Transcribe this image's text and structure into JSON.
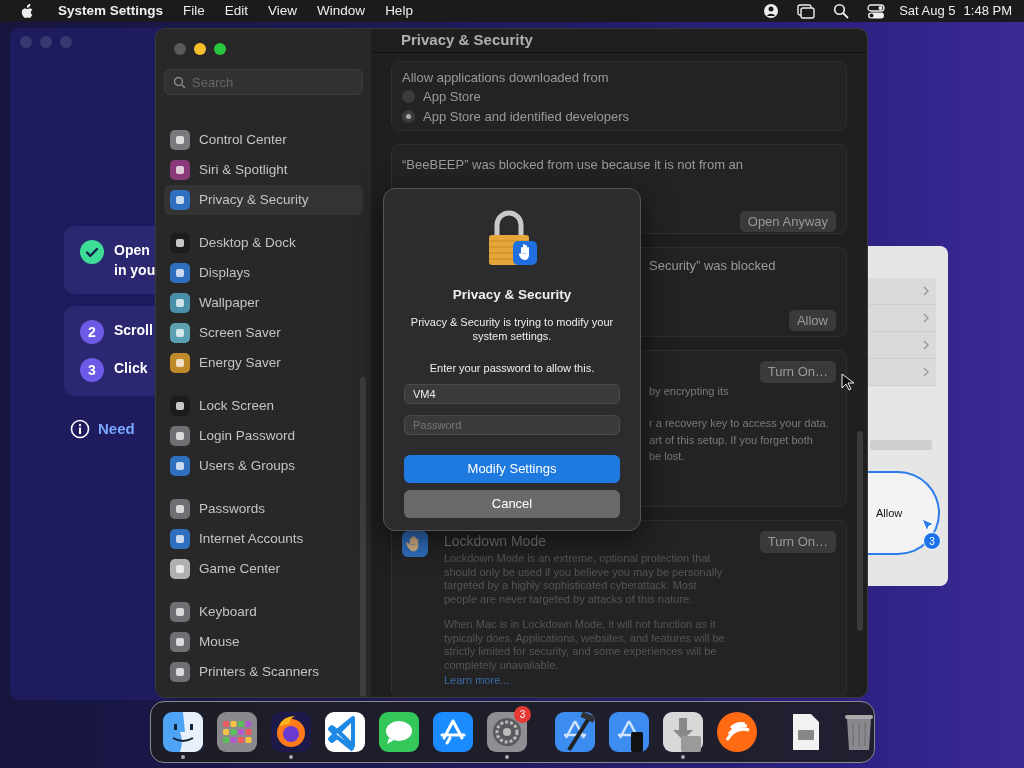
{
  "menubar": {
    "app": "System Settings",
    "menus": [
      "File",
      "Edit",
      "View",
      "Window",
      "Help"
    ],
    "date": "Sat Aug 5",
    "time": "1:48 PM"
  },
  "guide_window": {
    "cards": [
      {
        "steps": [
          {
            "lines": [
              "Open",
              "in you"
            ],
            "done": true
          }
        ]
      },
      {
        "steps": [
          {
            "number": "2",
            "lines": [
              "Scroll"
            ],
            "done": false
          },
          {
            "number": "3",
            "lines": [
              "Click"
            ],
            "done": false
          }
        ]
      }
    ],
    "help_link": "Need"
  },
  "tutorial_window": {
    "callout": {
      "label": "Allow",
      "badge": "3"
    }
  },
  "settings": {
    "search": {
      "placeholder": "Search"
    },
    "sidebar": {
      "groups": [
        {
          "items": [
            {
              "label": "Control Center",
              "color": "#7a7a7e",
              "selected": false
            },
            {
              "label": "Siri & Spotlight",
              "color": "#8a3a7a",
              "selected": false
            },
            {
              "label": "Privacy & Security",
              "color": "#2f6fc0",
              "selected": true
            }
          ]
        },
        {
          "items": [
            {
              "label": "Desktop & Dock",
              "color": "#1c1c1e",
              "selected": false
            },
            {
              "label": "Displays",
              "color": "#2f6fc0",
              "selected": false
            },
            {
              "label": "Wallpaper",
              "color": "#4a8fa8",
              "selected": false
            },
            {
              "label": "Screen Saver",
              "color": "#5aa0b0",
              "selected": false
            },
            {
              "label": "Energy Saver",
              "color": "#c08a2a",
              "selected": false
            }
          ]
        },
        {
          "items": [
            {
              "label": "Lock Screen",
              "color": "#1c1c1e",
              "selected": false
            },
            {
              "label": "Login Password",
              "color": "#6e6e73",
              "selected": false
            },
            {
              "label": "Users & Groups",
              "color": "#2f6fc0",
              "selected": false
            }
          ]
        },
        {
          "items": [
            {
              "label": "Passwords",
              "color": "#6e6e73",
              "selected": false
            },
            {
              "label": "Internet Accounts",
              "color": "#2f6fc0",
              "selected": false
            },
            {
              "label": "Game Center",
              "color": "#b0b0b0",
              "selected": false
            }
          ]
        },
        {
          "items": [
            {
              "label": "Keyboard",
              "color": "#6e6e73",
              "selected": false
            },
            {
              "label": "Mouse",
              "color": "#6e6e73",
              "selected": false
            },
            {
              "label": "Printers & Scanners",
              "color": "#6e6e73",
              "selected": false
            }
          ]
        }
      ]
    },
    "title": "Privacy & Security",
    "sections": [
      {
        "kind": "radios",
        "heading": "Allow applications downloaded from",
        "options": [
          {
            "label": "App Store",
            "selected": false
          },
          {
            "label": "App Store and identified developers",
            "selected": true
          }
        ]
      },
      {
        "kind": "notice",
        "text": "“BeeBEEP” was blocked from use because it is not from an",
        "button": "Open Anyway"
      },
      {
        "kind": "covered_notice",
        "paragraphs": [
          [
            "Security” was blocked"
          ]
        ],
        "button": "Allow",
        "button_first": false
      },
      {
        "kind": "covered_notice",
        "paragraphs": [
          [
            "by encrypting its"
          ],
          [
            "r a recovery key to access your data.",
            "art of this setup. If you forget both",
            "be lost."
          ]
        ],
        "button": "Turn On…",
        "button_first": true
      },
      {
        "kind": "feature",
        "title": "Lockdown Mode",
        "paragraphs": [
          "Lockdown Mode is an extreme, optional protection that should only be used if you believe you may be personally targeted by a highly sophisticated cyberattack. Most people are never targeted by attacks of this nature.",
          "When Mac is in Lockdown Mode, it will not function as it typically does. Applications, websites, and features will be strictly limited for security, and some experiences will be completely unavailable."
        ],
        "link": "Learn more...",
        "button": "Turn On…"
      }
    ]
  },
  "dialog": {
    "title": "Privacy & Security",
    "message": "Privacy & Security is trying to modify your system settings.",
    "prompt": "Enter your password to allow this.",
    "username": "VM4",
    "password_placeholder": "Password",
    "buttons": [
      {
        "label": "Modify Settings",
        "default": true
      },
      {
        "label": "Cancel",
        "default": false
      }
    ]
  },
  "dock": {
    "sections": [
      {
        "items": [
          {
            "running": true
          },
          {
            "running": false
          },
          {
            "running": true
          },
          {
            "running": false
          },
          {
            "running": false
          },
          {
            "running": false
          },
          {
            "running": true,
            "badge": "3"
          }
        ]
      },
      {
        "items": [
          {
            "running": false
          },
          {
            "running": false
          },
          {
            "running": true
          },
          {
            "running": false
          }
        ]
      },
      {
        "items": [
          {
            "running": false
          },
          {
            "running": false
          }
        ]
      }
    ]
  }
}
